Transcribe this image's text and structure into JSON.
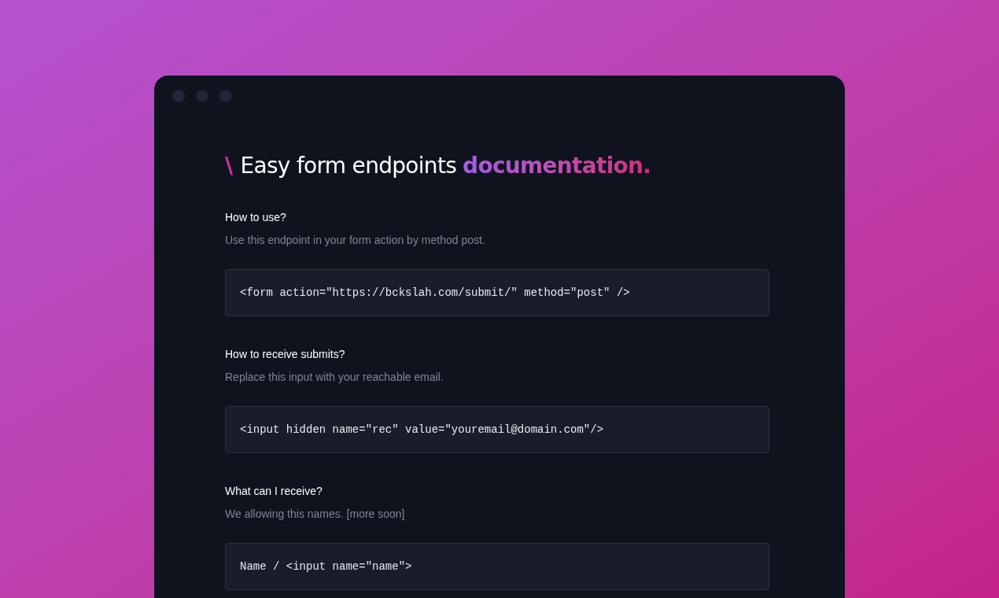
{
  "title": {
    "mark": "\\",
    "text": "Easy form endpoints",
    "highlight": "documentation."
  },
  "sections": [
    {
      "heading": "How to use?",
      "description": "Use this endpoint in your form action by method post.",
      "code": "<form action=\"https://bckslah.com/submit/\" method=\"post\" />"
    },
    {
      "heading": "How to receive submits?",
      "description": "Replace this input with your reachable email.",
      "code": "<input hidden name=\"rec\" value=\"youremail@domain.com\"/>"
    },
    {
      "heading": "What can I receive?",
      "description": "We allowing this names. [more soon]",
      "code": "Name / <input name=\"name\">"
    }
  ]
}
